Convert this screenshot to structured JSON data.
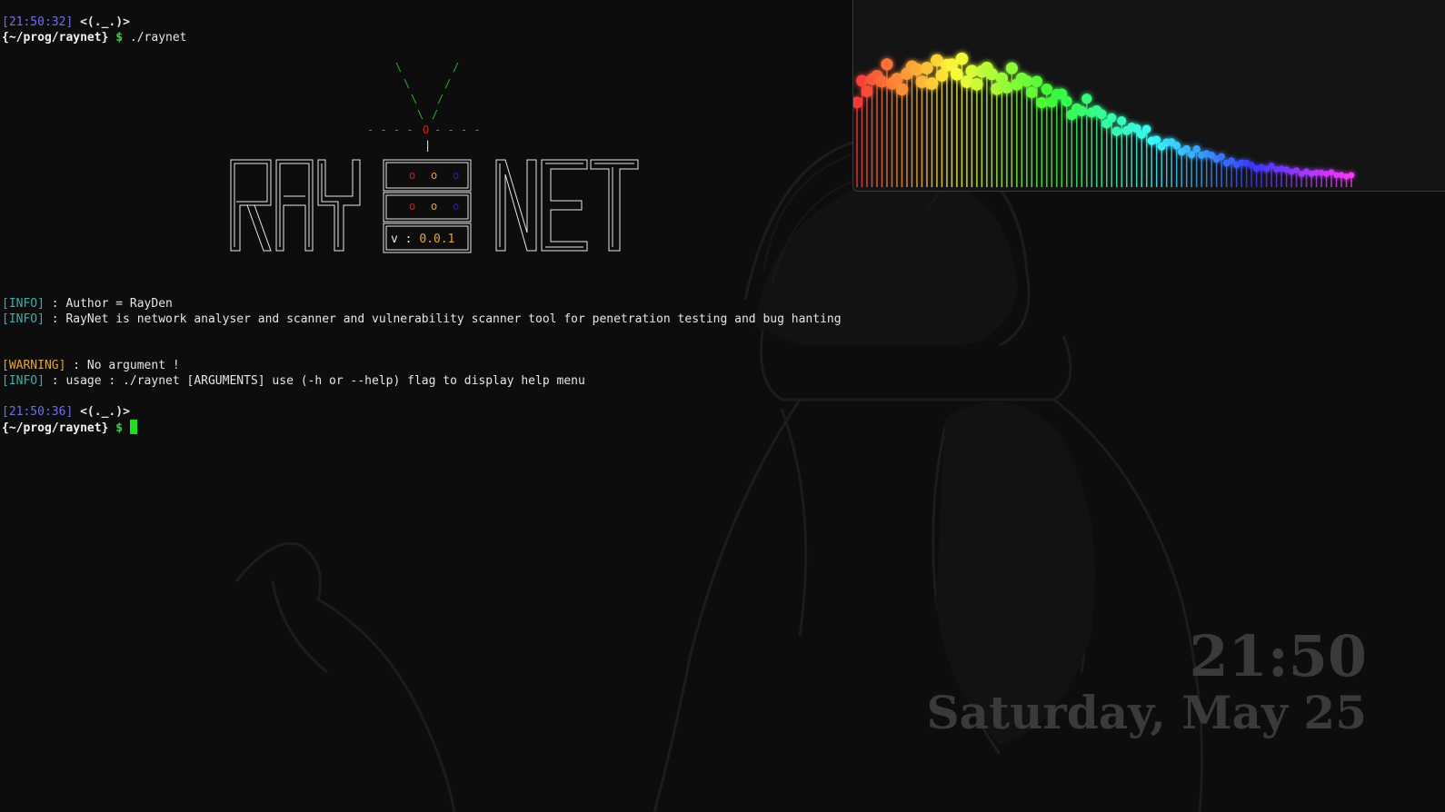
{
  "session1": {
    "timestamp": "[21:50:32]",
    "face": "<(._.)>",
    "path": "{~/prog/raynet}",
    "dollar": "$",
    "command": "./raynet"
  },
  "banner": {
    "title": "RAY NET",
    "version_label": "v : ",
    "version_number": "0.0.1"
  },
  "messages": [
    {
      "tag": "[INFO]",
      "text": " : Author = RayDen"
    },
    {
      "tag": "[INFO]",
      "text": " : RayNet is network analyser and scanner and vulnerability scanner tool for penetration testing and bug hanting"
    },
    {
      "tag": "[WARNING]",
      "text": " : No argument !"
    },
    {
      "tag": "[INFO]",
      "text": " : usage : ./raynet [ARGUMENTS] use (-h or --help) flag to display help menu"
    }
  ],
  "session2": {
    "timestamp": "[21:50:36]",
    "face": "<(._.)>",
    "path": "{~/prog/raynet}",
    "dollar": "$"
  },
  "clock": {
    "time": "21:50",
    "date": "Saturday, May 25"
  },
  "colors": {
    "timestamp": "#6f6ff2",
    "prompt_dollar": "#3ad43a",
    "info": "#2fb4b4",
    "warning": "#e8a336",
    "cursor": "#1ee01e"
  }
}
